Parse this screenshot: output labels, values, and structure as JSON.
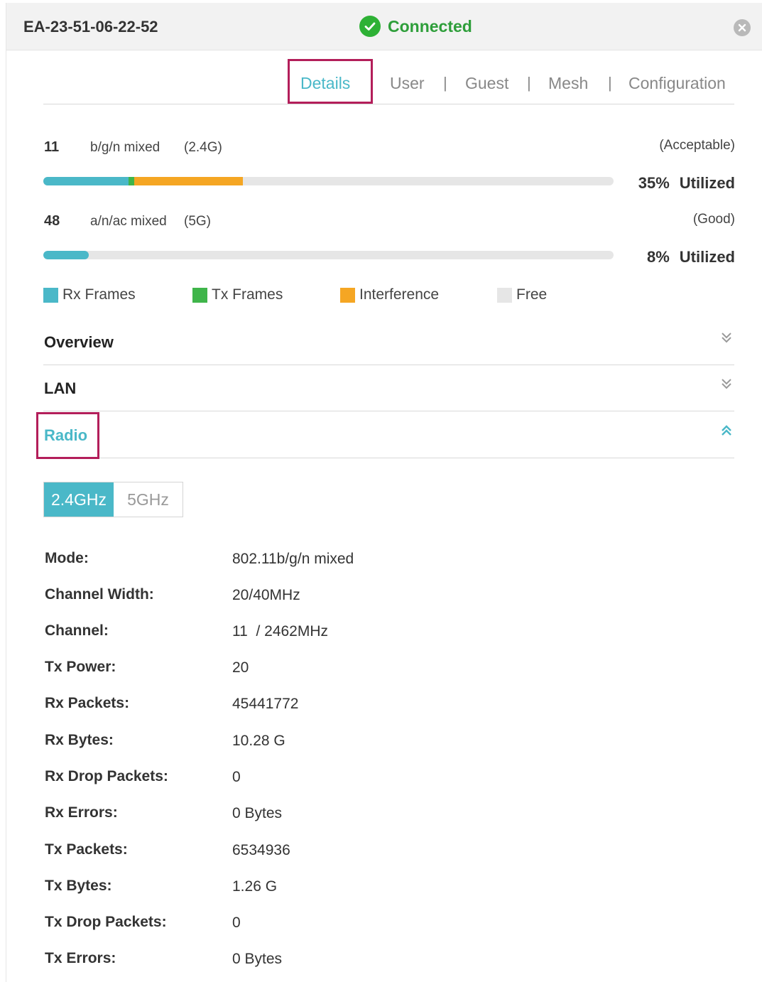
{
  "header": {
    "device_name": "EA-23-51-06-22-52",
    "status": "Connected",
    "status_color": "#2eb135"
  },
  "tabs": [
    {
      "label": "Details",
      "active": true
    },
    {
      "label": "User",
      "active": false
    },
    {
      "label": "Guest",
      "active": false
    },
    {
      "label": "Mesh",
      "active": false
    },
    {
      "label": "Configuration",
      "active": false
    }
  ],
  "tab_separator": "|",
  "channels": [
    {
      "number": "11",
      "mode": "b/g/n mixed",
      "band": "(2.4G)",
      "rating": "(Acceptable)",
      "utilization": "35%",
      "utilized_label": "Utilized",
      "rx_fraction": 0.15,
      "tx_fraction": 0.01,
      "interference_fraction": 0.19
    },
    {
      "number": "48",
      "mode": "a/n/ac mixed",
      "band": "(5G)",
      "rating": "(Good)",
      "utilization": "8%",
      "utilized_label": "Utilized",
      "rx_fraction": 0.08,
      "tx_fraction": 0.0,
      "interference_fraction": 0.0
    }
  ],
  "legend": [
    {
      "label": "Rx Frames",
      "color": "#4ab8c8"
    },
    {
      "label": "Tx Frames",
      "color": "#3fb54a"
    },
    {
      "label": "Interference",
      "color": "#f5a623"
    },
    {
      "label": "Free",
      "color": "#e6e6e6"
    }
  ],
  "sections": [
    {
      "title": "Overview",
      "expanded": false
    },
    {
      "title": "LAN",
      "expanded": false
    },
    {
      "title": "Radio",
      "expanded": true
    }
  ],
  "radio": {
    "bands": [
      "2.4GHz",
      "5GHz"
    ],
    "selected_band": "2.4GHz",
    "fields": [
      {
        "label": "Mode:",
        "value": "802.11b/g/n mixed"
      },
      {
        "label": "Channel Width:",
        "value": "20/40MHz"
      },
      {
        "label": "Channel:",
        "value": "11  / 2462MHz"
      },
      {
        "label": "Tx Power:",
        "value": "20"
      },
      {
        "label": "Rx Packets:",
        "value": "45441772"
      },
      {
        "label": "Rx Bytes:",
        "value": "10.28 G"
      },
      {
        "label": "Rx Drop Packets:",
        "value": "0"
      },
      {
        "label": "Rx Errors:",
        "value": "0 Bytes"
      },
      {
        "label": "Tx Packets:",
        "value": "6534936"
      },
      {
        "label": "Tx Bytes:",
        "value": "1.26 G"
      },
      {
        "label": "Tx Drop Packets:",
        "value": "0"
      },
      {
        "label": "Tx Errors:",
        "value": "0 Bytes"
      }
    ]
  },
  "colors": {
    "accent": "#4ab8c8",
    "highlight_box": "#b31e5a"
  }
}
